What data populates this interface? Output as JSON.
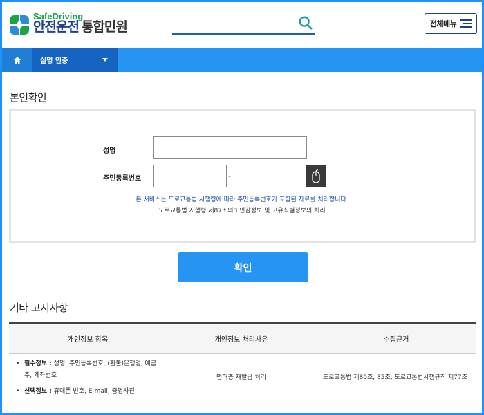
{
  "header": {
    "brand": "SafeDriving",
    "title_main": "안전운전",
    "title_sub": "통합민원",
    "search_placeholder": "",
    "menu_label": "전체메뉴"
  },
  "nav": {
    "home_icon": "home-icon",
    "selected": "실명 인증"
  },
  "verify": {
    "section_title": "본인확인",
    "name_label": "성명",
    "rrn_label": "주민등록번호",
    "dash": "-",
    "notice_line1": "본 서비스는 도로교통법 시행령에 따라 주민등록번호가 포함된 자료를 처리합니다.",
    "notice_line2": "도로교통법 시행령 제87조의3 민감정보 및 고유식별정보의 처리",
    "confirm_label": "확인"
  },
  "other": {
    "section_title": "기타 고지사항",
    "columns": [
      "개인정보 항목",
      "개인정보 처리사유",
      "수집근거"
    ],
    "rows": [
      {
        "items": [
          {
            "key": "필수정보 :",
            "value": " 성명, 주민등록번호, (환불)은행명, 예금주, 계좌번호"
          },
          {
            "key": "선택정보 :",
            "value": " 휴대폰 번호, E-mail, 증명사진"
          }
        ],
        "reason": "면허증 재발급 처리",
        "basis": "도로교통법 제80조, 85조, 도로교통법시행규칙 제77조"
      }
    ]
  },
  "colors": {
    "accent": "#2694f2",
    "nav_dark": "#1564c2",
    "brand_green": "#1aa34a",
    "title_navy": "#1d3f8f",
    "frame": "#1e90ff"
  }
}
